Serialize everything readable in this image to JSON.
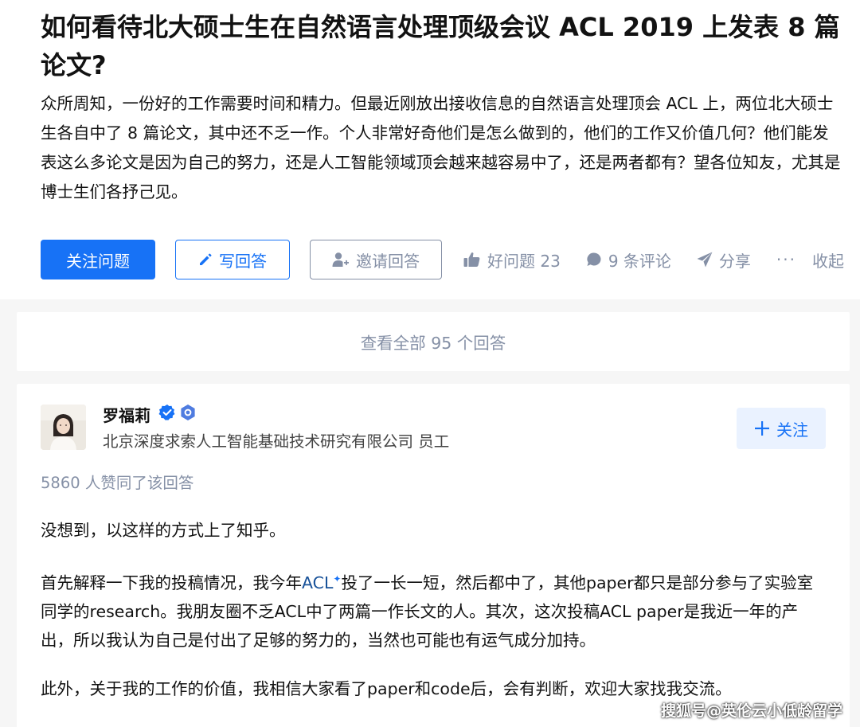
{
  "question": {
    "title": "如何看待北大硕士生在自然语言处理顶级会议 ACL 2019 上发表 8 篇论文?",
    "detail": "众所周知，一份好的工作需要时间和精力。但最近刚放出接收信息的自然语言处理顶会 ACL 上，两位北大硕士生各自中了 8 篇论文，其中还不乏一作。个人非常好奇他们是怎么做到的，他们的工作又价值几何？他们能发表这么多论文是因为自己的努力，还是人工智能领域顶会越来越容易中了，还是两者都有？望各位知友，尤其是博士生们各抒己见。"
  },
  "actions": {
    "follow_question": "关注问题",
    "write_answer": "写回答",
    "invite_answer": "邀请回答",
    "good_question": "好问题 23",
    "comments": "9 条评论",
    "share": "分享",
    "more": "···",
    "collapse": "收起"
  },
  "view_all": "查看全部 95 个回答",
  "answer": {
    "author_name": "罗福莉",
    "author_bio": "北京深度求索人工智能基础技术研究有限公司 员工",
    "follow_label": "关注",
    "votes": "5860 人赞同了该回答",
    "p1": "没想到，以这样的方式上了知乎。",
    "p2_before": "首先解释一下我的投稿情况，我今年",
    "p2_keyword": "ACL",
    "p2_after": "投了一长一短，然后都中了，其他paper都只是部分参与了实验室同学的research。我朋友圈不乏ACL中了两篇一作长文的人。其次，这次投稿ACL paper是我近一年的产出，所以我认为自己是付出了足够的努力的，当然也可能也有运气成分加持。",
    "p3": "此外，关于我的工作的价值，我相信大家看了paper和code后，会有判断，欢迎大家找我交流。"
  },
  "watermark": "搜狐号@英伦云小低龄留学",
  "colors": {
    "primary": "#1772f6",
    "gray": "#8590a6",
    "keyword": "#175199"
  }
}
